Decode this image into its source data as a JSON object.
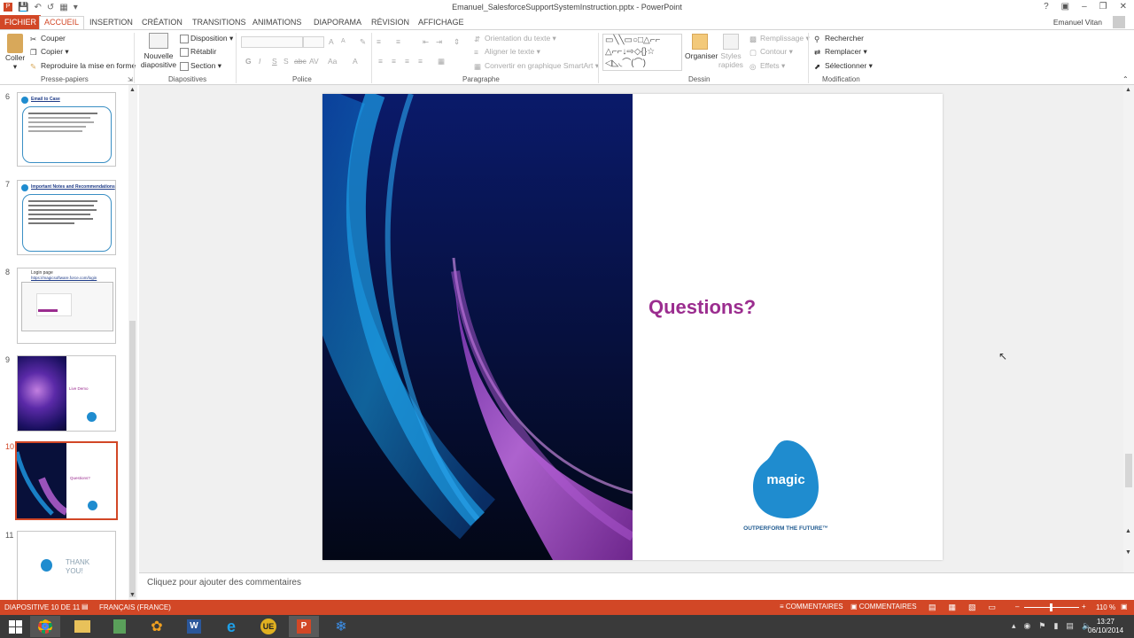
{
  "window": {
    "title": "Emanuel_SalesforceSupportSystemInstruction.pptx - PowerPoint",
    "user": "Emanuel Vitan"
  },
  "tabs": [
    "FICHIER",
    "ACCUEIL",
    "INSERTION",
    "CRÉATION",
    "TRANSITIONS",
    "ANIMATIONS",
    "DIAPORAMA",
    "RÉVISION",
    "AFFICHAGE"
  ],
  "ribbon": {
    "clipboard": {
      "paste": "Coller",
      "cut": "Couper",
      "copy": "Copier",
      "format_painter": "Reproduire la mise en forme",
      "label": "Presse-papiers"
    },
    "slides": {
      "new_slide": "Nouvelle diapositive",
      "layout": "Disposition",
      "reset": "Rétablir",
      "section": "Section",
      "label": "Diapositives"
    },
    "font": {
      "label": "Police",
      "bold": "G",
      "italic": "I",
      "underline": "S",
      "strike": "S",
      "abc": "abc",
      "av": "AV",
      "aa": "Aa",
      "grow": "A",
      "shrink": "A",
      "clear": "A"
    },
    "paragraph": {
      "text_direction": "Orientation du texte",
      "align_text": "Aligner le texte",
      "smartart": "Convertir en graphique SmartArt",
      "label": "Paragraphe"
    },
    "drawing": {
      "arrange": "Organiser",
      "quick_styles": "Styles rapides",
      "fill": "Remplissage",
      "outline": "Contour",
      "effects": "Effets",
      "label": "Dessin"
    },
    "editing": {
      "find": "Rechercher",
      "replace": "Remplacer",
      "select": "Sélectionner",
      "label": "Modification"
    }
  },
  "thumbnails": [
    {
      "num": "6",
      "title": "Email to Case"
    },
    {
      "num": "7",
      "title": "Important Notes and Recommendations"
    },
    {
      "num": "8",
      "title": "Login page",
      "subtitle": "https://magicsoftware.force.com/login"
    },
    {
      "num": "9",
      "title": "Live Demo"
    },
    {
      "num": "10",
      "title": "Questions?"
    },
    {
      "num": "11",
      "title": "THANK YOU!"
    }
  ],
  "slide": {
    "heading": "Questions?",
    "logo_text": "magic",
    "tagline": "OUTPERFORM THE FUTURE™"
  },
  "notes_placeholder": "Cliquez pour ajouter des commentaires",
  "status": {
    "slide": "DIAPOSITIVE 10 DE 11",
    "language": "FRANÇAIS (FRANCE)",
    "notes": "COMMENTAIRES",
    "comments": "COMMENTAIRES",
    "zoom": "110 %"
  },
  "taskbar": {
    "time": "13:27",
    "date": "06/10/2014"
  },
  "colors": {
    "accent": "#d24726",
    "heading": "#9b2d8f",
    "logo": "#1f8ccf"
  }
}
